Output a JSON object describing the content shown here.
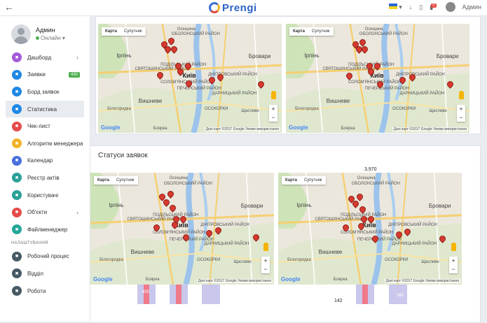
{
  "topbar": {
    "logo_text": "Prengi",
    "admin_label": "Админ",
    "notif_count": "0"
  },
  "user": {
    "name": "Админ",
    "status": "Онлайн"
  },
  "nav": [
    {
      "label": "Дашборд",
      "icon": "dashboard-icon",
      "color": "#a45ad9",
      "arrow": true
    },
    {
      "label": "Заявки",
      "icon": "requests-icon",
      "color": "#1e88e5",
      "badge": "430"
    },
    {
      "label": "Борд заявок",
      "icon": "board-icon",
      "color": "#1e88e5"
    },
    {
      "label": "Статистика",
      "icon": "stats-icon",
      "color": "#1e88e5",
      "active": true
    },
    {
      "label": "Чек-лист",
      "icon": "checklist-icon",
      "color": "#e54b4b"
    },
    {
      "label": "Алгоритм менеджера",
      "icon": "algorithm-icon",
      "color": "#f0b429"
    },
    {
      "label": "Календар",
      "icon": "calendar-icon",
      "color": "#4a6ee0"
    },
    {
      "label": "Реєстр актів",
      "icon": "registry-icon",
      "color": "#2aa198"
    },
    {
      "label": "Користувачі",
      "icon": "users-icon",
      "color": "#2aa198"
    },
    {
      "label": "Об'єкти",
      "icon": "objects-icon",
      "color": "#e54b4b",
      "arrow": true
    },
    {
      "label": "Файлменеджер",
      "icon": "file-manager-icon",
      "color": "#26a69a"
    }
  ],
  "settings_section": "Налаштування",
  "settings_nav": [
    {
      "label": "Робочий процес",
      "icon": "workflow-icon",
      "color": "#455a64"
    },
    {
      "label": "Відділ",
      "icon": "department-icon",
      "color": "#455a64"
    },
    {
      "label": "Роботи",
      "icon": "tools-icon",
      "color": "#455a64"
    }
  ],
  "section2_title": "Статуси заявок",
  "map": {
    "type_map": "Карта",
    "type_sat": "Супутник",
    "attribution": "Дані карт ©2017 Google   Умови використання",
    "google": "Google",
    "labels": {
      "obolon": "ОБОЛОНСЬКИЙ РАЙОН",
      "podil": "ПОДІЛЬСЬКИЙ РАЙОН",
      "irpin": "Ірпінь",
      "brovary": "Бровари",
      "svyat": "СВЯТОШИНСЬКИЙ РАЙОН",
      "kyiv": "Київ",
      "dnipro": "ДНІПРОВСЬКИЙ РАЙОН",
      "solomyan": "СОЛОМ'ЯНСЬКИЙ РАЙОН",
      "pechersk": "ПЕЧЕРСЬКИЙ РАЙОН",
      "darnytsia": "ДАРНИЦЬКИЙ РАЙОН",
      "vyshneve": "Вишневе",
      "bilogorod": "Білогородка",
      "boyarka": "Боярка",
      "shchaslyve": "Щасливе",
      "osokory": "ОСОКОРКИ",
      "oseschyna": "Осещина"
    }
  },
  "values": {
    "top_number": "3,970",
    "bottom_number": "142",
    "bar_a": "435",
    "bar_b": "360"
  }
}
